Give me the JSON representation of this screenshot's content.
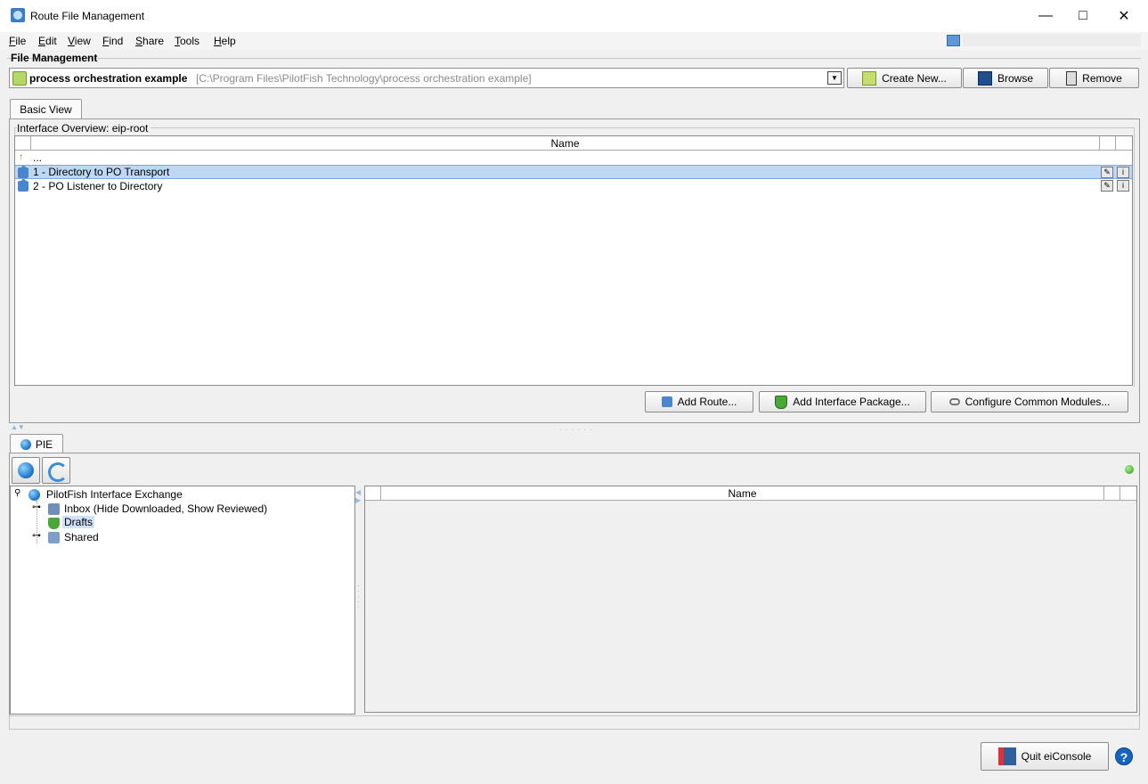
{
  "window": {
    "title": "Route File Management",
    "minimize": "—",
    "maximize": "□",
    "close": "✕"
  },
  "menu": [
    {
      "key": "F",
      "rest": "ile"
    },
    {
      "key": "E",
      "rest": "dit"
    },
    {
      "key": "V",
      "rest": "iew"
    },
    {
      "key": "F",
      "rest": "ind"
    },
    {
      "key": "S",
      "rest": "hare"
    },
    {
      "key": "T",
      "rest": "ools"
    },
    {
      "key": "H",
      "rest": "elp"
    }
  ],
  "file_management": {
    "title": "File Management",
    "project_name": "process orchestration example",
    "project_path": "[C:\\Program Files\\PilotFish Technology\\process orchestration example]",
    "create_new_label": "Create New...",
    "browse_label": "Browse",
    "remove_label": "Remove"
  },
  "basic_view": {
    "tab_label": "Basic View",
    "overview_label": "Interface Overview: eip-root",
    "column_name": "Name",
    "parent_row": "...",
    "routes": [
      {
        "label": "1 - Directory to PO Transport",
        "selected": true
      },
      {
        "label": "2 - PO Listener to Directory",
        "selected": false
      }
    ],
    "add_route_label": "Add Route...",
    "add_package_label": "Add Interface Package...",
    "configure_modules_label": "Configure Common Modules..."
  },
  "pie": {
    "tab_label": "PIE",
    "tree": {
      "root": "PilotFish Interface Exchange",
      "inbox": "Inbox (Hide Downloaded, Show Reviewed)",
      "drafts": "Drafts",
      "shared": "Shared"
    },
    "column_name": "Name",
    "status_color": "#2f9b1f"
  },
  "footer": {
    "quit_label": "Quit eiConsole",
    "help_glyph": "?"
  }
}
